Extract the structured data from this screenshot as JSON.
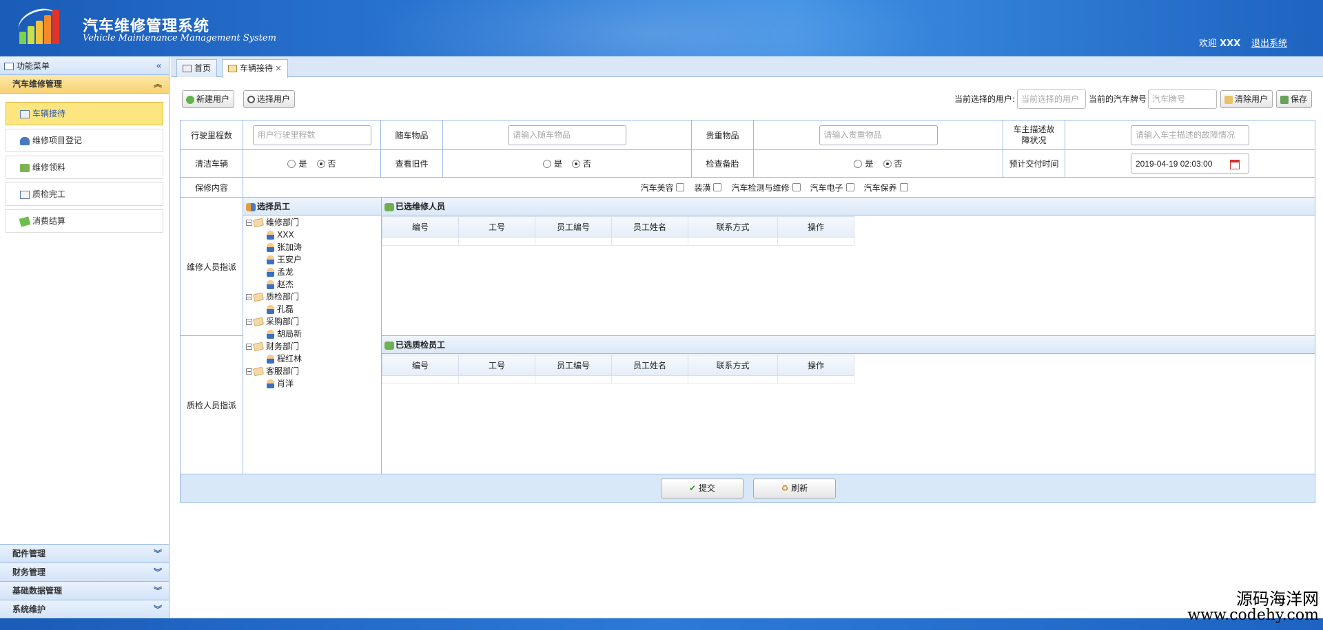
{
  "header": {
    "title_cn": "汽车维修管理系统",
    "title_en": "Vehicle Maintenance Management System",
    "welcome_prefix": "欢迎",
    "username": "XXX",
    "logout": "退出系统"
  },
  "sidebar": {
    "header": "功能菜单",
    "open_section": "汽车维修管理",
    "items": [
      {
        "label": "车辆接待"
      },
      {
        "label": "维修项目登记"
      },
      {
        "label": "维修领料"
      },
      {
        "label": "质检完工"
      },
      {
        "label": "消费结算"
      }
    ],
    "sections": [
      "配件管理",
      "财务管理",
      "基础数据管理",
      "系统维护"
    ]
  },
  "tabs": [
    {
      "label": "首页"
    },
    {
      "label": "车辆接待",
      "close": "×"
    }
  ],
  "toolbar": {
    "new_user": "新建用户",
    "select_user": "选择用户",
    "current_user_label": "当前选择的用户:",
    "current_user_placeholder": "当前选择的用户",
    "plate_label": "当前的汽车牌号",
    "plate_placeholder": "汽车牌号",
    "clear_user": "清除用户",
    "save": "保存"
  },
  "form": {
    "mileage_label": "行驶里程数",
    "mileage_placeholder": "用户行驶里程数",
    "carry_label": "随车物品",
    "carry_placeholder": "请输入随车物品",
    "valuables_label": "贵重物品",
    "valuables_placeholder": "请输入贵重物品",
    "fault_label": "车主描述故障状况",
    "fault_placeholder": "请输入车主描述的故障情况",
    "wash_label": "清洁车辆",
    "oldparts_label": "查看旧件",
    "spare_label": "检查备胎",
    "yes": "是",
    "no": "否",
    "delivery_label": "预计交付时间",
    "delivery_value": "2019-04-19 02:03:00",
    "service_label": "保修内容",
    "service_options": [
      "汽车美容",
      "装潢",
      "汽车检测与维修",
      "汽车电子",
      "汽车保养"
    ],
    "repair_assign_label": "维修人员指派",
    "qc_assign_label": "质检人员指派"
  },
  "tree": {
    "title": "选择员工",
    "departments": [
      {
        "name": "维修部门",
        "members": [
          "XXX",
          "张加涛",
          "王安户",
          "孟龙",
          "赵杰"
        ]
      },
      {
        "name": "质检部门",
        "members": [
          "孔磊"
        ]
      },
      {
        "name": "采购部门",
        "members": [
          "胡局新"
        ]
      },
      {
        "name": "财务部门",
        "members": [
          "程红林"
        ]
      },
      {
        "name": "客服部门",
        "members": [
          "肖洋"
        ]
      }
    ]
  },
  "repair_panel": {
    "title": "已选维修人员",
    "columns": [
      "编号",
      "工号",
      "员工编号",
      "员工姓名",
      "联系方式",
      "操作"
    ]
  },
  "qc_panel": {
    "title": "已选质检员工",
    "columns": [
      "编号",
      "工号",
      "员工编号",
      "员工姓名",
      "联系方式",
      "操作"
    ]
  },
  "actions": {
    "submit": "提交",
    "refresh": "刷新"
  },
  "watermark": {
    "line1": "源码海洋网",
    "line2": "www.codehy.com"
  },
  "colors": {
    "header": "#2c7ad6",
    "border": "#99bbe8",
    "active_menu": "#fde680"
  }
}
